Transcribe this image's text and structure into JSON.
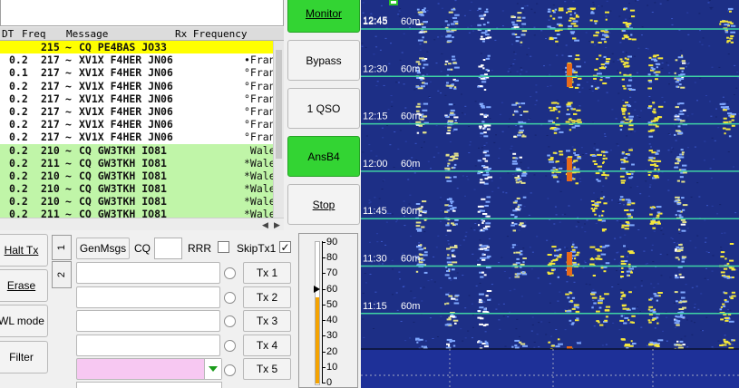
{
  "list": {
    "headers": {
      "dt": "DT",
      "freq": "Freq",
      "message": "Message",
      "rx": "Rx Frequency"
    },
    "rows": [
      {
        "dt": "",
        "freq": "215",
        "sep": "~",
        "msg": "CQ PE4BAS JO33",
        "rx": "",
        "hl": "yellow"
      },
      {
        "dt": "0.2",
        "freq": "217",
        "sep": "~",
        "msg": "XV1X F4HER JN06",
        "rx": "•Fran",
        "hl": ""
      },
      {
        "dt": "0.1",
        "freq": "217",
        "sep": "~",
        "msg": "XV1X F4HER JN06",
        "rx": "°Fran",
        "hl": ""
      },
      {
        "dt": "0.2",
        "freq": "217",
        "sep": "~",
        "msg": "XV1X F4HER JN06",
        "rx": "°Fran",
        "hl": ""
      },
      {
        "dt": "0.2",
        "freq": "217",
        "sep": "~",
        "msg": "XV1X F4HER JN06",
        "rx": "°Fran",
        "hl": ""
      },
      {
        "dt": "0.2",
        "freq": "217",
        "sep": "~",
        "msg": "XV1X F4HER JN06",
        "rx": "°Fran",
        "hl": ""
      },
      {
        "dt": "0.2",
        "freq": "217",
        "sep": "~",
        "msg": "XV1X F4HER JN06",
        "rx": "°Fran",
        "hl": ""
      },
      {
        "dt": "0.2",
        "freq": "217",
        "sep": "~",
        "msg": "XV1X F4HER JN06",
        "rx": "°Fran",
        "hl": ""
      },
      {
        "dt": "0.2",
        "freq": "210",
        "sep": "~",
        "msg": "CQ GW3TKH IO81",
        "rx": " Wale",
        "hl": "green"
      },
      {
        "dt": "0.2",
        "freq": "211",
        "sep": "~",
        "msg": "CQ GW3TKH IO81",
        "rx": "*Wale",
        "hl": "green"
      },
      {
        "dt": "0.2",
        "freq": "210",
        "sep": "~",
        "msg": "CQ GW3TKH IO81",
        "rx": "*Wale",
        "hl": "green"
      },
      {
        "dt": "0.2",
        "freq": "210",
        "sep": "~",
        "msg": "CQ GW3TKH IO81",
        "rx": "*Wale",
        "hl": "green"
      },
      {
        "dt": "0.2",
        "freq": "210",
        "sep": "~",
        "msg": "CQ GW3TKH IO81",
        "rx": "*Wale",
        "hl": "green"
      },
      {
        "dt": "0.2",
        "freq": "211",
        "sep": "~",
        "msg": "CQ GW3TKH IO81",
        "rx": "*Wale",
        "hl": "green"
      }
    ]
  },
  "buttons": {
    "monitor": "Monitor",
    "bypass": "Bypass",
    "one_qso": "1 QSO",
    "ansb4": "AnsB4",
    "stop": "Stop",
    "halt_tx": "Halt Tx",
    "erase": "Erase",
    "wl_mode": "WL mode",
    "filter": "Filter"
  },
  "tabs": {
    "tab1": "1",
    "tab2": "2"
  },
  "controls": {
    "genmsgs": "GenMsgs",
    "cq_label": "CQ",
    "rrr_label": "RRR",
    "skiptx1_label": "SkipTx1",
    "skiptx1_checked": true,
    "rrr_checked": false,
    "tx_buttons": [
      "Tx 1",
      "Tx 2",
      "Tx 3",
      "Tx 4",
      "Tx 5"
    ]
  },
  "meter": {
    "ticks": [
      "90",
      "80",
      "70",
      "60",
      "50",
      "40",
      "30",
      "20",
      "10",
      "0"
    ],
    "level": 55
  },
  "waterfall": {
    "band_label": "60m",
    "times": [
      "12:45",
      "12:30",
      "12:15",
      "12:00",
      "11:45",
      "11:30",
      "11:15"
    ]
  },
  "colors": {
    "monitor_green": "#33d433",
    "yellow_highlight": "#ffff00",
    "green_highlight": "#c0f5a8",
    "meter_orange": "#f5a300",
    "tx5_pink": "#f7c8f2"
  }
}
